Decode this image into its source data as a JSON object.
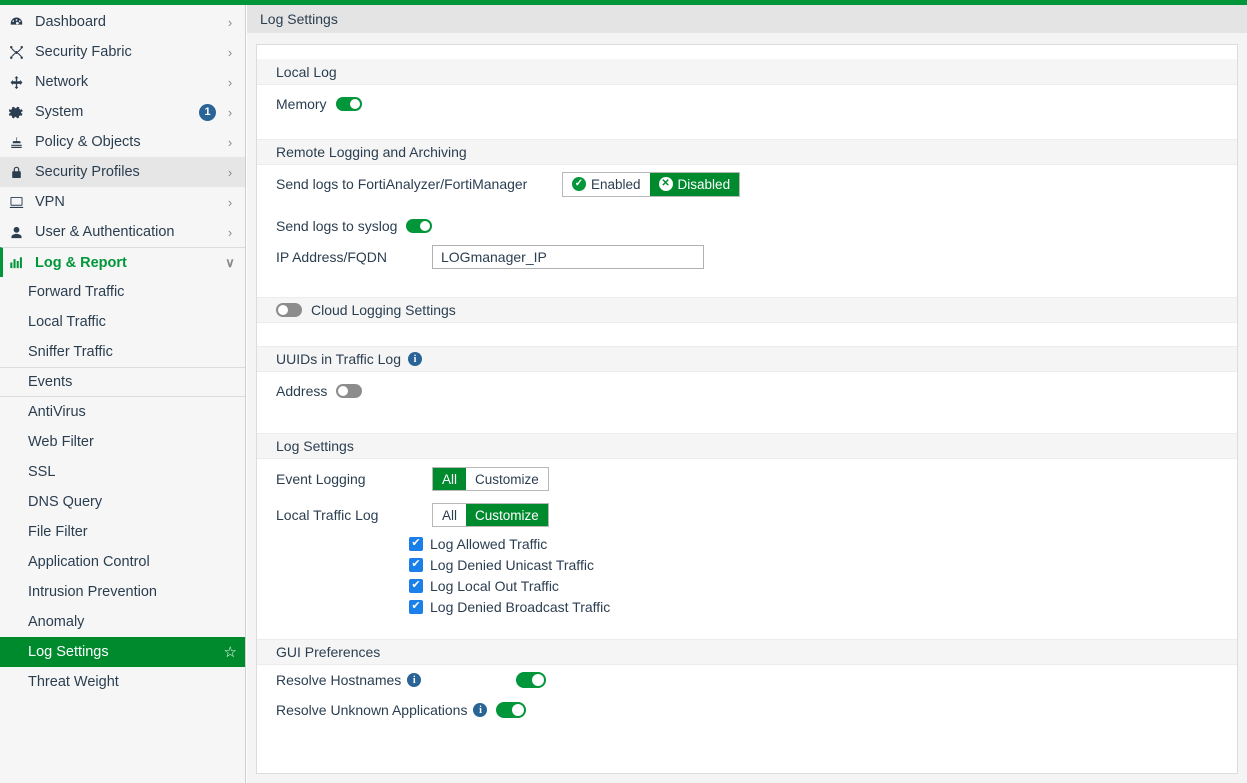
{
  "theme": {
    "accent_green": "#009639",
    "selected_green": "#008a2e",
    "badge_blue": "#2a6496",
    "checkbox_blue": "#1a7fe8",
    "header_gray": "#e4e4e4",
    "section_gray": "#f5f5f5"
  },
  "header": {
    "title": "Log Settings"
  },
  "sidebar": {
    "items": [
      {
        "label": "Dashboard",
        "icon": "dashboard-icon",
        "chevron": "›",
        "badge": ""
      },
      {
        "label": "Security Fabric",
        "icon": "security-fabric-icon",
        "chevron": "›",
        "badge": ""
      },
      {
        "label": "Network",
        "icon": "network-icon",
        "chevron": "›",
        "badge": ""
      },
      {
        "label": "System",
        "icon": "gear-icon",
        "chevron": "›",
        "badge": "1"
      },
      {
        "label": "Policy & Objects",
        "icon": "policy-icon",
        "chevron": "›",
        "badge": ""
      },
      {
        "label": "Security Profiles",
        "icon": "lock-icon",
        "chevron": "›",
        "badge": ""
      },
      {
        "label": "VPN",
        "icon": "monitor-icon",
        "chevron": "›",
        "badge": ""
      },
      {
        "label": "User & Authentication",
        "icon": "user-icon",
        "chevron": "›",
        "badge": ""
      }
    ],
    "log_report": {
      "label": "Log & Report",
      "icon": "bar-chart-icon",
      "chevron": "∨"
    },
    "sub_items": [
      {
        "label": "Forward Traffic"
      },
      {
        "label": "Local Traffic"
      },
      {
        "label": "Sniffer Traffic"
      },
      {
        "label": "Events"
      },
      {
        "label": "AntiVirus"
      },
      {
        "label": "Web Filter"
      },
      {
        "label": "SSL"
      },
      {
        "label": "DNS Query"
      },
      {
        "label": "File Filter"
      },
      {
        "label": "Application Control"
      },
      {
        "label": "Intrusion Prevention"
      },
      {
        "label": "Anomaly"
      },
      {
        "label": "Log Settings"
      },
      {
        "label": "Threat Weight"
      }
    ],
    "favorite_star": "☆"
  },
  "local_log": {
    "section_title": "Local Log",
    "memory_label": "Memory",
    "memory_on": true
  },
  "remote_logging": {
    "section_title": "Remote Logging and Archiving",
    "fortianalyzer_label": "Send logs to FortiAnalyzer/FortiManager",
    "enabled_label": "Enabled",
    "disabled_label": "Disabled",
    "selected": "Disabled",
    "syslog_label": "Send logs to syslog",
    "syslog_on": true,
    "ip_label": "IP Address/FQDN",
    "ip_value": "LOGmanager_IP",
    "ip_placeholder": ""
  },
  "cloud_logging": {
    "section_title": "Cloud Logging Settings",
    "enabled": false
  },
  "uuids": {
    "section_title": "UUIDs in Traffic Log",
    "info": "i",
    "address_label": "Address",
    "address_on": false
  },
  "log_settings": {
    "section_title": "Log Settings",
    "event_logging_label": "Event Logging",
    "event_logging_options": [
      "All",
      "Customize"
    ],
    "event_logging_selected": "All",
    "local_traffic_label": "Local Traffic Log",
    "local_traffic_options": [
      "All",
      "Customize"
    ],
    "local_traffic_selected": "Customize",
    "checkbox_mark": "✔",
    "checkboxes": [
      {
        "label": "Log Allowed Traffic",
        "checked": true
      },
      {
        "label": "Log Denied Unicast Traffic",
        "checked": true
      },
      {
        "label": "Log Local Out Traffic",
        "checked": true
      },
      {
        "label": "Log Denied Broadcast Traffic",
        "checked": true
      }
    ]
  },
  "gui_preferences": {
    "section_title": "GUI Preferences",
    "resolve_hostnames_label": "Resolve Hostnames",
    "resolve_hostnames_on": true,
    "resolve_unknown_label": "Resolve Unknown Applications",
    "resolve_unknown_on": true,
    "info": "i"
  }
}
